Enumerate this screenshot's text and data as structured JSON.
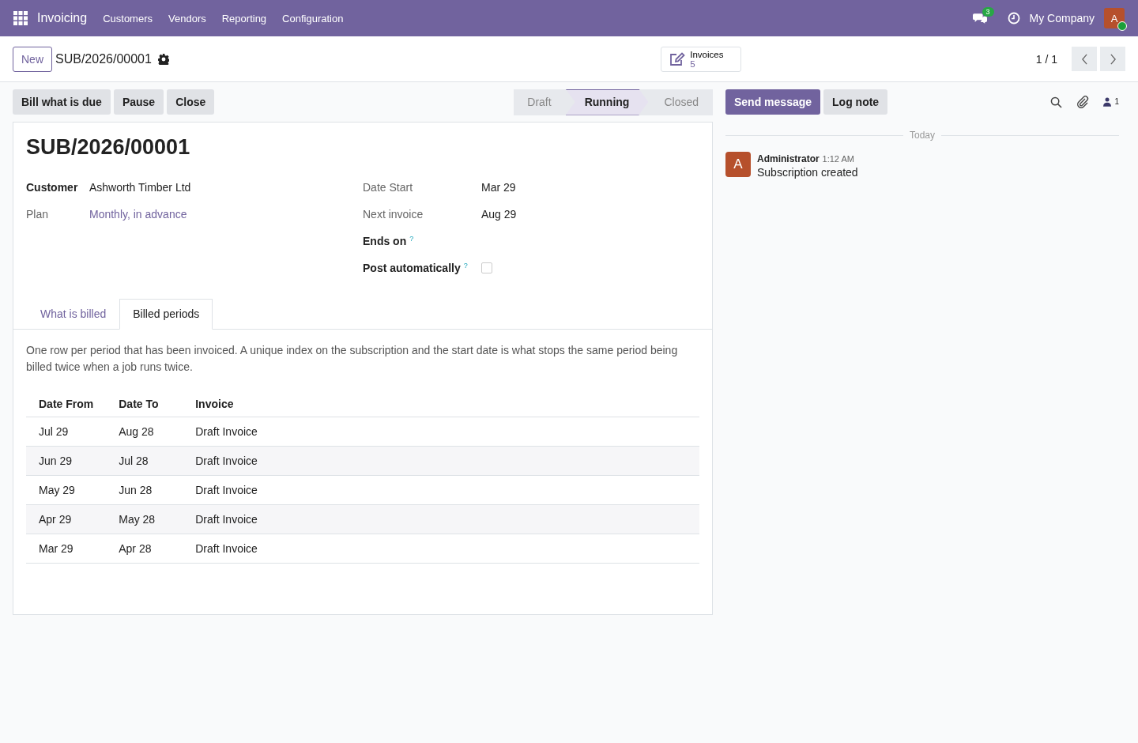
{
  "navbar": {
    "app": "Invoicing",
    "menus": [
      "Customers",
      "Vendors",
      "Reporting",
      "Configuration"
    ],
    "messages_badge": "3",
    "company": "My Company",
    "avatar": "A"
  },
  "control_panel": {
    "new_button": "New",
    "breadcrumb": "SUB/2026/00001",
    "smart_button": {
      "label": "Invoices",
      "count": "5"
    },
    "pager": "1 / 1"
  },
  "actions": [
    "Bill what is due",
    "Pause",
    "Close"
  ],
  "stages": [
    {
      "label": "Draft",
      "selected": false
    },
    {
      "label": "Running",
      "selected": true
    },
    {
      "label": "Closed",
      "selected": false
    }
  ],
  "form": {
    "title": "SUB/2026/00001",
    "left_fields": [
      {
        "label": "Customer",
        "strong": true,
        "kind": "text",
        "value": "Ashworth Timber Ltd"
      },
      {
        "label": "Plan",
        "strong": false,
        "kind": "link",
        "value": "Monthly, in advance"
      }
    ],
    "right_fields": [
      {
        "label": "Date Start",
        "strong": false,
        "kind": "text",
        "value": "Mar 29"
      },
      {
        "label": "Next invoice",
        "strong": false,
        "kind": "text",
        "value": "Aug 29"
      },
      {
        "label": "Ends on",
        "strong": true,
        "help": "?",
        "kind": "empty"
      },
      {
        "label": "Post automatically",
        "strong": true,
        "help": "?",
        "kind": "checkbox",
        "checked": false
      }
    ],
    "tabs": [
      {
        "label": "What is billed",
        "selected": false
      },
      {
        "label": "Billed periods",
        "selected": true
      }
    ],
    "note": "One row per period that has been invoiced. A unique index on the subscription and the start date is what stops the same period being billed twice when a job runs twice.",
    "table": {
      "columns": [
        "Date From",
        "Date To",
        "Invoice"
      ],
      "rows": [
        [
          "Jul 29",
          "Aug 28",
          "Draft Invoice"
        ],
        [
          "Jun 29",
          "Jul 28",
          "Draft Invoice"
        ],
        [
          "May 29",
          "Jun 28",
          "Draft Invoice"
        ],
        [
          "Apr 29",
          "May 28",
          "Draft Invoice"
        ],
        [
          "Mar 29",
          "Apr 28",
          "Draft Invoice"
        ]
      ]
    }
  },
  "chatter": {
    "send_button": "Send message",
    "log_button": "Log note",
    "followers_count": "1",
    "separator": "Today",
    "messages": [
      {
        "avatar": "A",
        "author": "Administrator",
        "time": "1:12 AM",
        "body": "Subscription created"
      }
    ]
  }
}
